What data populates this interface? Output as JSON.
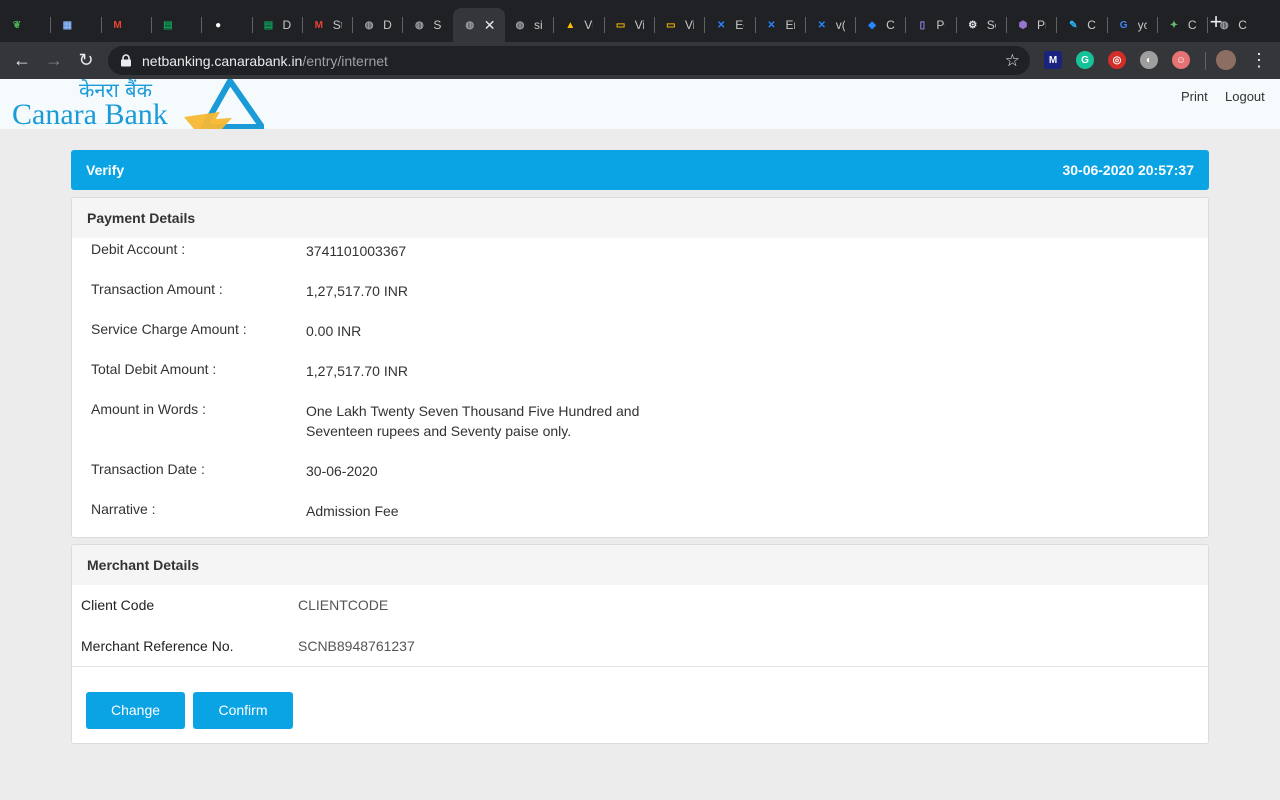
{
  "browser": {
    "tabs": [
      {
        "icon": "leaf-icon",
        "title": "",
        "color": "#4caf50"
      },
      {
        "icon": "calendar-icon",
        "title": "",
        "color": "#8ab4f8"
      },
      {
        "icon": "gmail-icon",
        "title": "",
        "color": "#ea4335"
      },
      {
        "icon": "sheets-icon",
        "title": "",
        "color": "#0f9d58"
      },
      {
        "icon": "github-icon",
        "title": "",
        "color": "#ffffff"
      },
      {
        "icon": "sheets-icon",
        "title": "D",
        "color": "#0f9d58"
      },
      {
        "icon": "gmail-icon",
        "title": "St",
        "color": "#ea4335"
      },
      {
        "icon": "globe-icon",
        "title": "D",
        "color": "#9aa0a6"
      },
      {
        "icon": "globe-icon",
        "title": "Sc",
        "color": "#9aa0a6"
      },
      {
        "icon": "globe-icon",
        "title": "",
        "color": "#9aa0a6",
        "active": true
      },
      {
        "icon": "globe-icon",
        "title": "si",
        "color": "#9aa0a6"
      },
      {
        "icon": "drive-icon",
        "title": "Vi",
        "color": "#fbbc04"
      },
      {
        "icon": "slides-icon",
        "title": "Vi",
        "color": "#f4b400"
      },
      {
        "icon": "slides-icon",
        "title": "Vi",
        "color": "#f4b400"
      },
      {
        "icon": "confluence-icon",
        "title": "Ec",
        "color": "#2684ff"
      },
      {
        "icon": "confluence-icon",
        "title": "Er",
        "color": "#2684ff"
      },
      {
        "icon": "confluence-icon",
        "title": "v(",
        "color": "#2684ff"
      },
      {
        "icon": "jira-icon",
        "title": "Cl",
        "color": "#2684ff"
      },
      {
        "icon": "doc-icon",
        "title": "Pc",
        "color": "#8c8cf0"
      },
      {
        "icon": "gear-icon",
        "title": "Se",
        "color": "#e8eaed"
      },
      {
        "icon": "box-icon",
        "title": "Pr",
        "color": "#9575cd"
      },
      {
        "icon": "pencil-icon",
        "title": "C",
        "color": "#29b6f6"
      },
      {
        "icon": "google-icon",
        "title": "yc",
        "color": "#4285f4"
      },
      {
        "icon": "bird-icon",
        "title": "C",
        "color": "#66bb6a"
      },
      {
        "icon": "globe-icon",
        "title": "C",
        "color": "#9aa0a6"
      }
    ],
    "url_host": "netbanking.canarabank.in",
    "url_path": "/entry/internet",
    "extensions": [
      {
        "icon": "m-extension-icon",
        "label": "M",
        "color": "#1a237e"
      },
      {
        "icon": "grammarly-icon",
        "label": "G",
        "color": "#15c39a"
      },
      {
        "icon": "lastpass-icon",
        "label": "◎",
        "color": "#d32d27"
      },
      {
        "icon": "half-circle-icon",
        "label": "◐",
        "color": "#9e9e9e"
      },
      {
        "icon": "face-icon",
        "label": "☺",
        "color": "#e57373"
      },
      {
        "icon": "profile-avatar-icon",
        "label": "",
        "color": "#8d6e63"
      }
    ]
  },
  "brand": {
    "hindi": "केनरा बैंक",
    "english": "Canara Bank",
    "blue": "#1a9bd7",
    "yellow": "#f7b733"
  },
  "top_links": {
    "print": "Print",
    "logout": "Logout"
  },
  "verify_bar": {
    "label": "Verify",
    "datetime": "30-06-2020 20:57:37",
    "color": "#0aa4e5"
  },
  "payment": {
    "title": "Payment Details",
    "rows": [
      {
        "label": "Debit Account :",
        "value": "3741101003367"
      },
      {
        "label": "Transaction Amount :",
        "value": "1,27,517.70 INR"
      },
      {
        "label": "Service Charge Amount :",
        "value": "0.00 INR"
      },
      {
        "label": "Total Debit Amount :",
        "value": "1,27,517.70 INR"
      },
      {
        "label": "Amount in Words :",
        "value": "One Lakh Twenty Seven Thousand Five Hundred and Seventeen rupees and Seventy paise only."
      },
      {
        "label": "Transaction Date :",
        "value": "30-06-2020"
      },
      {
        "label": "Narrative :",
        "value": "Admission Fee"
      }
    ]
  },
  "merchant": {
    "title": "Merchant Details",
    "rows": [
      {
        "label": "Client Code",
        "value": "CLIENTCODE"
      },
      {
        "label": "Merchant Reference No.",
        "value": "SCNB8948761237"
      }
    ]
  },
  "actions": {
    "change": "Change",
    "confirm": "Confirm"
  }
}
